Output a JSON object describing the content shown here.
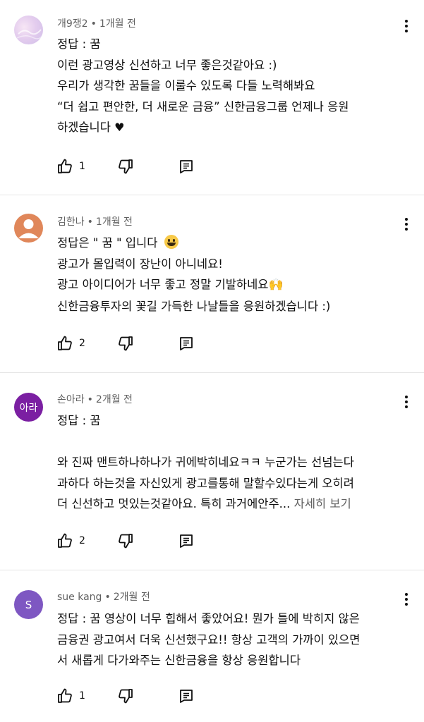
{
  "comments": [
    {
      "author": "개9쟁2",
      "time": "1개월 전",
      "avatar": {
        "type": "image",
        "colors": [
          "#f2d9f0",
          "#d7c7ee"
        ]
      },
      "lines": [
        "정답 : 꿈",
        "이런 광고영상 신선하고 너무 좋은것같아요 :)",
        "우리가 생각한 꿈들을 이룰수 있도록 다들 노력해봐요",
        "“더 쉽고 편안한, 더 새로운 금융”  신한금융그룹 언제나 응원",
        "하겠습니다"
      ],
      "heart": "♥",
      "likes": "1"
    },
    {
      "author": "김한나",
      "time": "1개월 전",
      "avatar": {
        "type": "default-person",
        "color": "#e0875a"
      },
      "lines": [
        "정답은 \" 꿈 \" 입니다",
        "광고가 몰입력이 장난이 아니네요!",
        "광고 아이디어가 너무 좋고 정말 기발하네요",
        "신한금융투자의 꽃길 가득한 나날들을 응원하겠습니다 :)"
      ],
      "emoji_hands": "🙌",
      "likes": "2"
    },
    {
      "author": "손아라",
      "time": "2개월 전",
      "avatar": {
        "type": "initials",
        "text": "아라",
        "color": "#7b1fa2"
      },
      "lines": [
        "정답 : 꿈",
        "",
        "와 진짜 맨트하나하나가 귀에박히네요ㅋㅋ  누군가는 선넘는다",
        "과하다 하는것을 자신있게 광고를통해 말할수있다는게 오히려",
        "더 신선하고 멋있는것같아요. 특히 과거에안주..."
      ],
      "read_more": "자세히 보기",
      "likes": "2"
    },
    {
      "author": "sue kang",
      "time": "2개월 전",
      "avatar": {
        "type": "initials",
        "text": "S",
        "color": "#7e57c2"
      },
      "lines": [
        "정답 : 꿈 영상이 너무 힙해서 좋았어요! 뭔가 틀에 박히지 않은",
        "금융권 광고여서 더욱 신선했구요!! 항상 고객의 가까이 있으면",
        "서 새롭게 다가와주는 신한금융을 항상 응원합니다"
      ],
      "likes": "1"
    }
  ],
  "icons": {
    "like": "thumbs-up-icon",
    "dislike": "thumbs-down-icon",
    "reply": "reply-icon",
    "more": "more-vert-icon"
  }
}
